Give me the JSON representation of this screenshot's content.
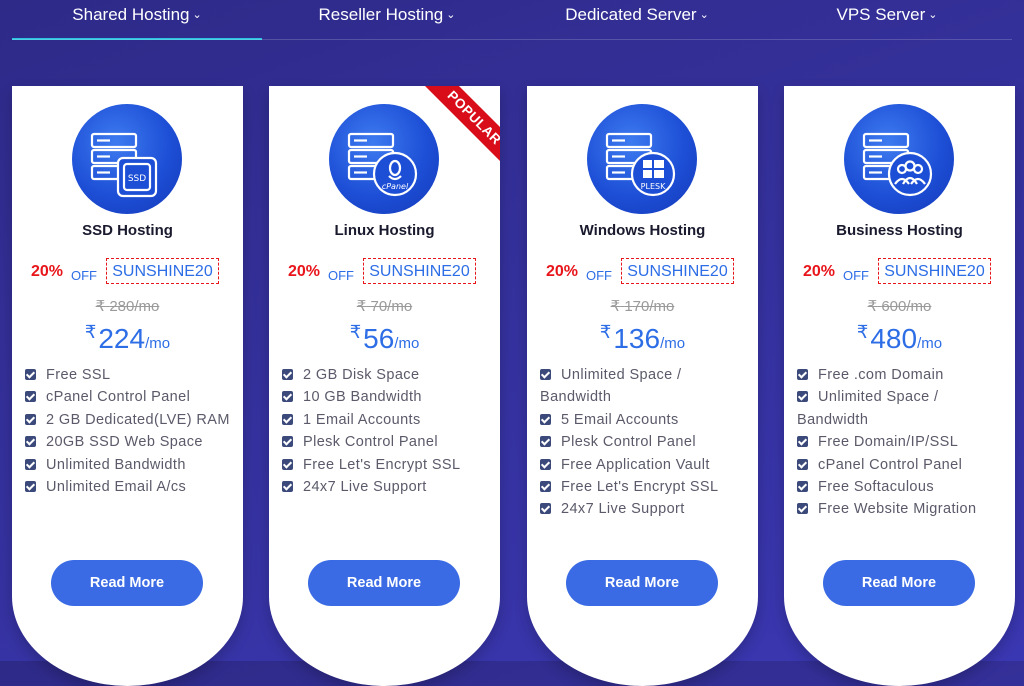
{
  "nav": {
    "tabs": [
      {
        "label": "Shared Hosting"
      },
      {
        "label": "Reseller Hosting"
      },
      {
        "label": "Dedicated Server"
      },
      {
        "label": "VPS Server"
      }
    ],
    "active_tab": "Shared Hosting",
    "chevron": "⌄",
    "accent_color": "#2bc3e0"
  },
  "colors": {
    "background": "#34309a",
    "discount": "#e8151b",
    "price": "#2d6ee6",
    "button": "#3a6be4",
    "ribbon": "#d90d19"
  },
  "cards": [
    {
      "icon": "ssd-server-icon",
      "icon_label": "SSD",
      "title": "SSD Hosting",
      "discount": "20%",
      "off": "OFF",
      "coupon": "SUNSHINE20",
      "currency": "₹",
      "old_price": "280/mo",
      "price": "224",
      "per": "/mo",
      "features": [
        "Free SSL",
        "cPanel Control Panel",
        "2 GB Dedicated(LVE) RAM",
        "20GB SSD Web Space",
        "Unlimited Bandwidth",
        "Unlimited Email A/cs"
      ],
      "button": "Read More"
    },
    {
      "icon": "cpanel-linux-server-icon",
      "icon_label": "cPanel",
      "title": "Linux Hosting",
      "ribbon": "POPULAR",
      "discount": "20%",
      "off": "OFF",
      "coupon": "SUNSHINE20",
      "currency": "₹",
      "old_price": "70/mo",
      "price": "56",
      "per": "/mo",
      "features": [
        "2 GB Disk Space",
        "10 GB Bandwidth",
        "1 Email Accounts",
        "Plesk Control Panel",
        "Free Let's Encrypt SSL",
        "24x7 Live Support"
      ],
      "button": "Read More"
    },
    {
      "icon": "plesk-windows-server-icon",
      "icon_label": "PLESK",
      "title": "Windows Hosting",
      "discount": "20%",
      "off": "OFF",
      "coupon": "SUNSHINE20",
      "currency": "₹",
      "old_price": "170/mo",
      "price": "136",
      "per": "/mo",
      "features": [
        "Unlimited Space / Bandwidth",
        "5 Email Accounts",
        "Plesk Control Panel",
        "Free Application Vault",
        "Free Let's Encrypt SSL",
        "24x7 Live Support"
      ],
      "button": "Read More"
    },
    {
      "icon": "business-team-server-icon",
      "title": "Business Hosting",
      "discount": "20%",
      "off": "OFF",
      "coupon": "SUNSHINE20",
      "currency": "₹",
      "old_price": "600/mo",
      "price": "480",
      "per": "/mo",
      "features": [
        "Free .com Domain",
        "Unlimited Space / Bandwidth",
        "Free Domain/IP/SSL",
        "cPanel Control Panel",
        "Free Softaculous",
        "Free Website Migration"
      ],
      "button": "Read More"
    }
  ]
}
